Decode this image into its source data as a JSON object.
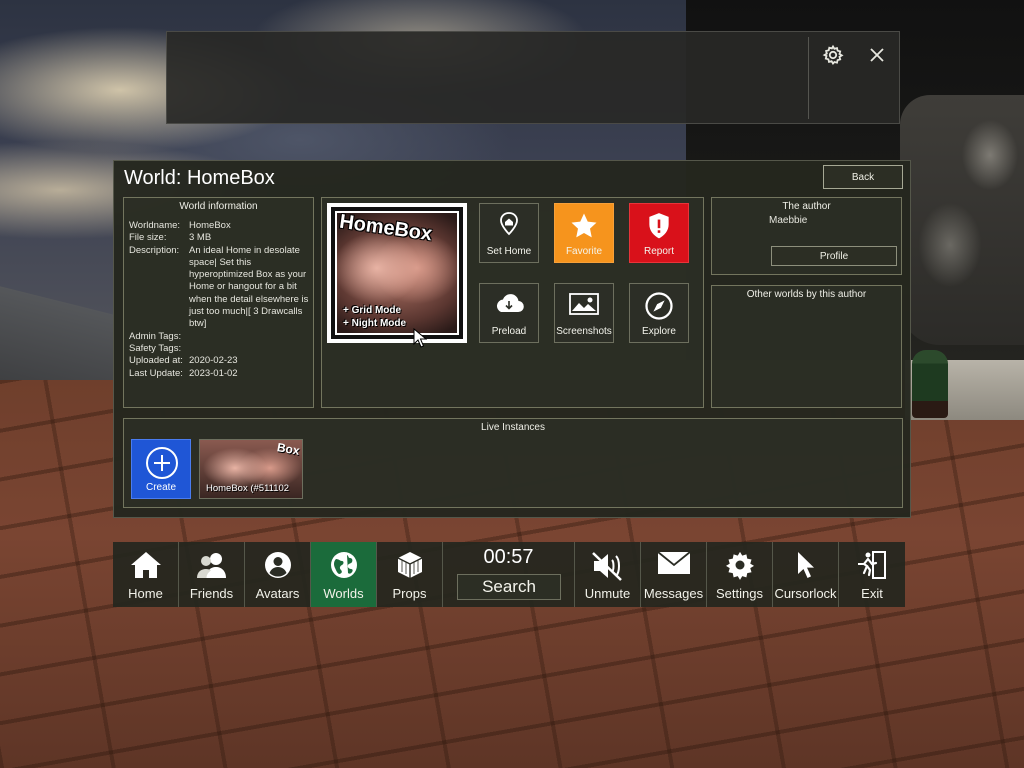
{
  "topbar": {
    "settings_icon": "gear-icon",
    "close_icon": "close-icon"
  },
  "world_panel": {
    "title": "World: HomeBox",
    "back_label": "Back",
    "info": {
      "heading": "World information",
      "rows": [
        {
          "key": "Worldname:",
          "value": "HomeBox"
        },
        {
          "key": "File size:",
          "value": "3 MB"
        },
        {
          "key": "Description:",
          "value": "An ideal Home in desolate space| Set this hyperoptimized Box as your Home or hangout for a bit when the detail elsewhere is just too much|[ 3 Drawcalls btw]"
        },
        {
          "key": "Admin Tags:",
          "value": ""
        },
        {
          "key": "Safety Tags:",
          "value": ""
        },
        {
          "key": "Uploaded at:",
          "value": "2020-02-23"
        },
        {
          "key": "Last Update:",
          "value": "2023-01-02"
        }
      ]
    },
    "thumbnail": {
      "title": "HomeBox",
      "caption1": "+ Grid Mode",
      "caption2": "+ Night Mode"
    },
    "actions": [
      {
        "label": "Set Home",
        "icon": "home-pin-icon"
      },
      {
        "label": "Favorite",
        "icon": "star-icon",
        "color": "#f6941d"
      },
      {
        "label": "Report",
        "icon": "shield-alert-icon",
        "color": "#d9111a"
      },
      {
        "label": "Preload",
        "icon": "cloud-download-icon"
      },
      {
        "label": "Screenshots",
        "icon": "image-icon"
      },
      {
        "label": "Explore",
        "icon": "compass-icon"
      }
    ],
    "author": {
      "heading": "The author",
      "name": "Maebbie",
      "profile_label": "Profile"
    },
    "other_worlds": {
      "heading": "Other worlds by this author"
    },
    "live_instances": {
      "heading": "Live Instances",
      "create_label": "Create",
      "instances": [
        {
          "label": "HomeBox (#511102",
          "caption": "Box"
        }
      ]
    }
  },
  "dock": {
    "clock": "00:57",
    "search_label": "Search",
    "items": [
      {
        "label": "Home",
        "icon": "house-icon"
      },
      {
        "label": "Friends",
        "icon": "friends-icon"
      },
      {
        "label": "Avatars",
        "icon": "avatar-icon"
      },
      {
        "label": "Worlds",
        "icon": "globe-icon",
        "active": true
      },
      {
        "label": "Props",
        "icon": "cube-icon"
      },
      {
        "label": "Unmute",
        "icon": "speaker-muted-icon"
      },
      {
        "label": "Messages",
        "icon": "envelope-icon"
      },
      {
        "label": "Settings",
        "icon": "gear-icon"
      },
      {
        "label": "Cursorlock",
        "icon": "cursor-icon"
      },
      {
        "label": "Exit",
        "icon": "exit-icon"
      }
    ],
    "active_color": "#1b6b3b"
  }
}
